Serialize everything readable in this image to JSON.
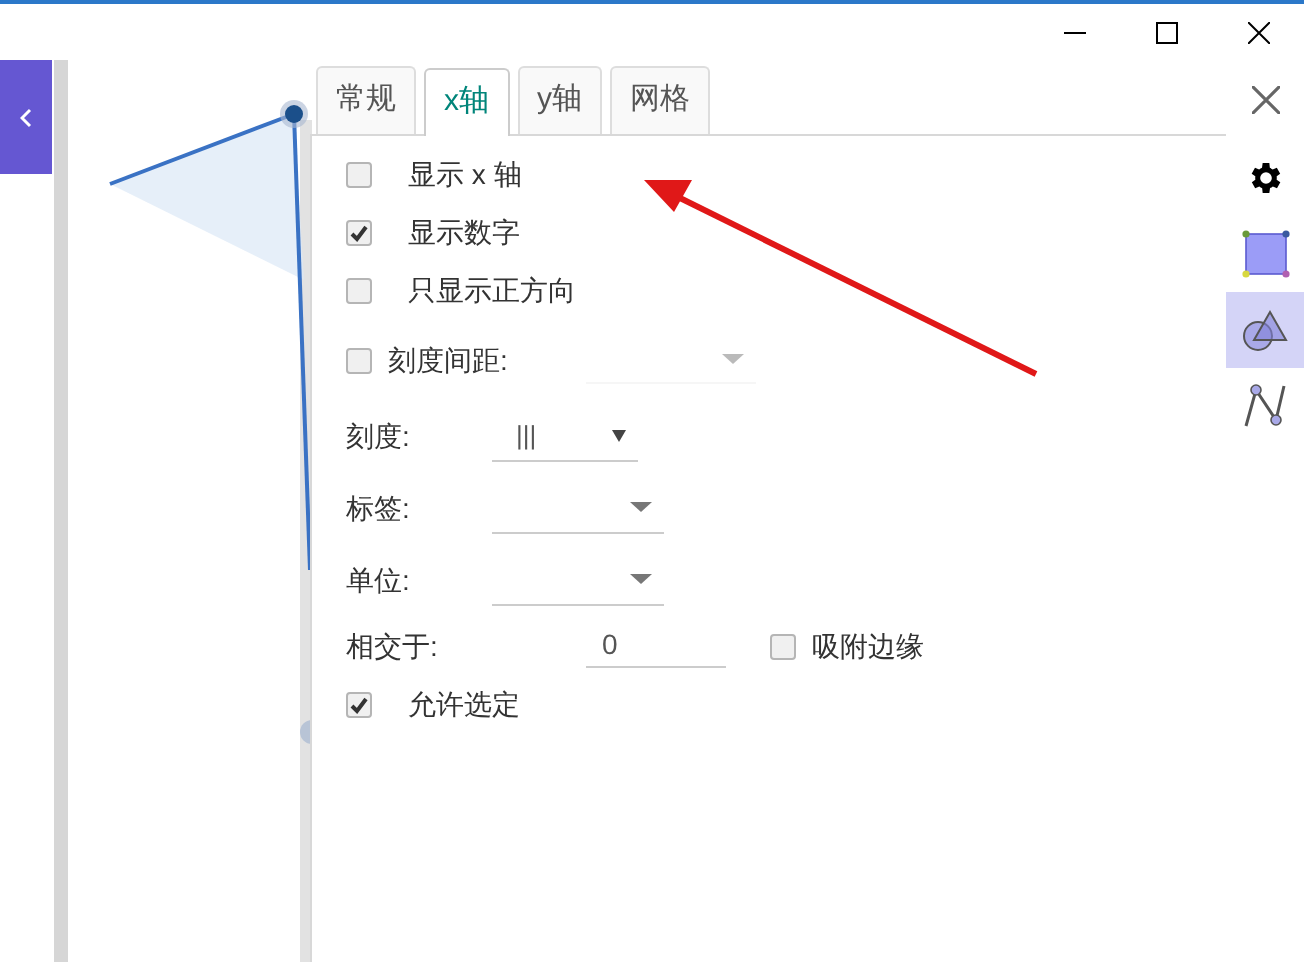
{
  "tabs": [
    {
      "label": "常规",
      "selected": false
    },
    {
      "label": "x轴",
      "selected": true
    },
    {
      "label": "y轴",
      "selected": false
    },
    {
      "label": "网格",
      "selected": false
    }
  ],
  "rows": [
    {
      "kind": "checkbox",
      "label": "显示 x 轴",
      "checked": false
    },
    {
      "kind": "checkbox",
      "label": "显示数字",
      "checked": true
    },
    {
      "kind": "checkbox",
      "label": "只显示正方向",
      "checked": false
    },
    {
      "kind": "checkbox_dropdown",
      "label": "刻度间距:",
      "checked": false,
      "disabled": true
    },
    {
      "kind": "dropdown",
      "label": "刻度:",
      "value": "|||"
    },
    {
      "kind": "dropdown",
      "label": "标签:"
    },
    {
      "kind": "dropdown",
      "label": "单位:"
    },
    {
      "kind": "input",
      "label": "相交于:",
      "value": "0",
      "option": {
        "label": "吸附边缘",
        "checked": false
      }
    },
    {
      "kind": "checkbox",
      "label": "允许选定",
      "checked": true
    }
  ],
  "tools": [
    {
      "kind": "settings",
      "selected": false
    },
    {
      "kind": "polygon",
      "selected": false
    },
    {
      "kind": "shapes",
      "selected": true
    },
    {
      "kind": "curve",
      "selected": false
    }
  ]
}
